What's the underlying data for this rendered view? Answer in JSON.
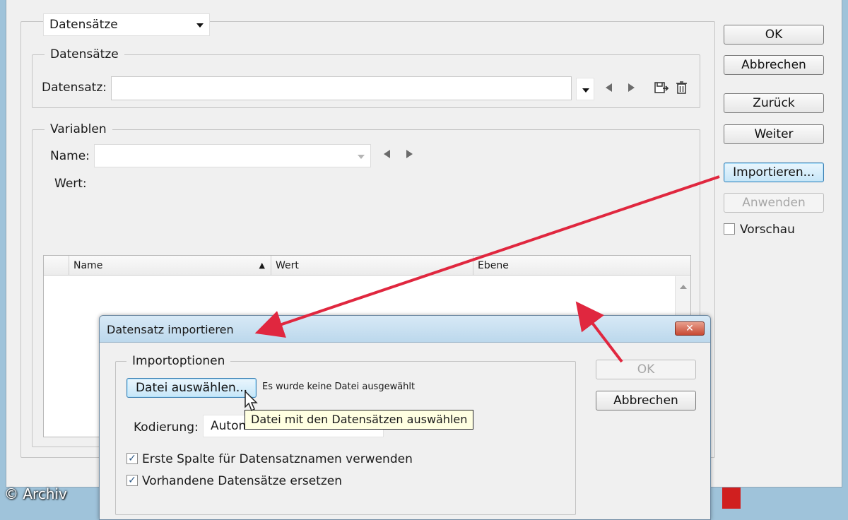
{
  "main": {
    "mode_select": {
      "value": "Datensätze"
    },
    "datasets_group": {
      "legend": "Datensätze",
      "dataset_label": "Datensatz:",
      "dataset_value": ""
    },
    "variables_group": {
      "legend": "Variablen",
      "name_label": "Name:",
      "name_value": "",
      "value_label": "Wert:",
      "table": {
        "columns": [
          "Name",
          "Wert",
          "Ebene"
        ],
        "sort_indicator": "▲",
        "rows": []
      }
    }
  },
  "side_buttons": {
    "ok": "OK",
    "cancel": "Abbrechen",
    "back": "Zurück",
    "next": "Weiter",
    "import": "Importieren...",
    "apply": "Anwenden",
    "preview": "Vorschau",
    "preview_checked": false
  },
  "dialog": {
    "title": "Datensatz importieren",
    "close": "✕",
    "options_legend": "Importoptionen",
    "choose_file_button": "Datei auswählen...",
    "no_file_text": "Es wurde keine Datei ausgewählt",
    "encoding_label": "Kodierung:",
    "encoding_value": "Automatisch",
    "checkbox_first_column": "Erste Spalte für Datensatznamen verwenden",
    "checkbox_first_column_checked": true,
    "checkbox_replace": "Vorhandene Datensätze ersetzen",
    "checkbox_replace_checked": true,
    "ok": "OK",
    "cancel": "Abbrechen"
  },
  "tooltip": {
    "text": "Datei mit den Datensätzen auswählen"
  },
  "watermark": "© Archiv",
  "colors": {
    "arrow": "#e0273f",
    "focus_button": "#c6e6f8",
    "window_bg": "#f0f0f0"
  }
}
